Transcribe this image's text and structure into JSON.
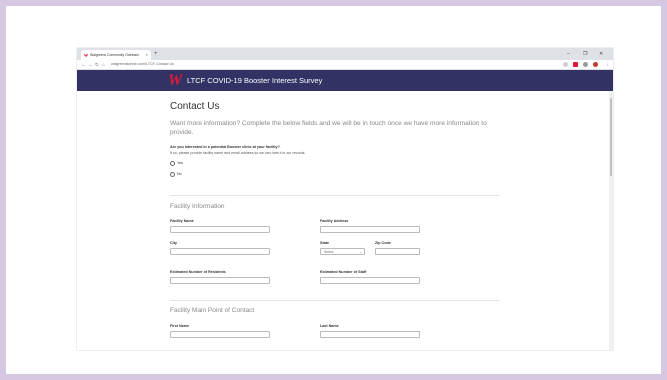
{
  "browser": {
    "tab_title": "Walgreens Community Outreach",
    "new_tab": "+",
    "url": "walgreenstorech.com/LTCF-Contact Us",
    "controls": {
      "minimize": "–",
      "maximize": "❐",
      "close": "✕"
    }
  },
  "app": {
    "logo": "W",
    "title": "LTCF COVID-19 Booster Interest Survey"
  },
  "form": {
    "heading": "Contact Us",
    "intro": "Want more information? Complete the below fields and we will be in touch once we have more information to provide.",
    "question": "Are you interested in a potential Booster clinic at your facility?",
    "hint": "If so, please provide facility name and email address so we can note it in our records.",
    "options": [
      "Yes",
      "No"
    ]
  },
  "facility": {
    "section_title": "Facility Information",
    "name_label": "Facility Name",
    "address_label": "Facility Address",
    "city_label": "City",
    "state_label": "State",
    "state_value": "Select",
    "zip_label": "Zip Code",
    "residents_label": "Estimated Number of Residents",
    "staff_label": "Estimated Number of Staff"
  },
  "contact": {
    "section_title": "Facility Main Point of Contact",
    "first_name_label": "First Name",
    "last_name_label": "Last Name"
  },
  "colors": {
    "background": "#d6c8e3",
    "appbar": "#323264",
    "logo": "#e31837"
  }
}
